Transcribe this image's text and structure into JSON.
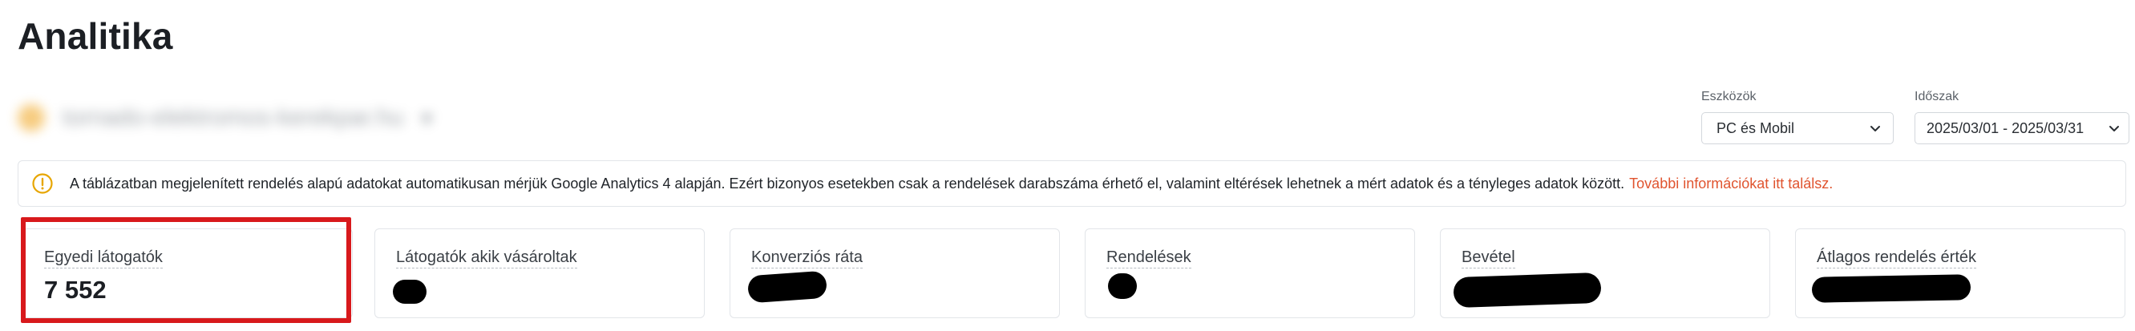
{
  "page": {
    "title": "Analitika"
  },
  "site_selector": {
    "name": "tornado-elektromos-kerekpar.hu",
    "chevron": "▾"
  },
  "filters": {
    "devices": {
      "label": "Eszközök",
      "value": "PC és Mobil"
    },
    "period": {
      "label": "Időszak",
      "value": "2025/03/01 - 2025/03/31"
    }
  },
  "notice": {
    "text": "A táblázatban megjelenített rendelés alapú adatokat automatikusan mérjük Google Analytics 4 alapján. Ezért bizonyos esetekben csak a rendelések darabszáma érhető el, valamint eltérések lehetnek a mért adatok és a tényleges adatok között.",
    "link": "További információkat itt találsz."
  },
  "kpis": [
    {
      "label": "Egyedi látogatók",
      "value": "7 552",
      "highlighted": true
    },
    {
      "label": "Látogatók akik vásároltak",
      "value": null,
      "redacted": true
    },
    {
      "label": "Konverziós ráta",
      "value": null,
      "redacted": true
    },
    {
      "label": "Rendelések",
      "value": null,
      "redacted": true
    },
    {
      "label": "Bevétel",
      "value": null,
      "redacted": true
    },
    {
      "label": "Átlagos rendelés érték",
      "value": null,
      "redacted": true
    }
  ],
  "colors": {
    "accent_link": "#e0542f",
    "highlight_border": "#d8191c",
    "warning_icon": "#e7a600"
  },
  "icons": {
    "notice": "warning-circle-icon",
    "select": "chevron-down-icon",
    "site": "site-logo-icon"
  }
}
